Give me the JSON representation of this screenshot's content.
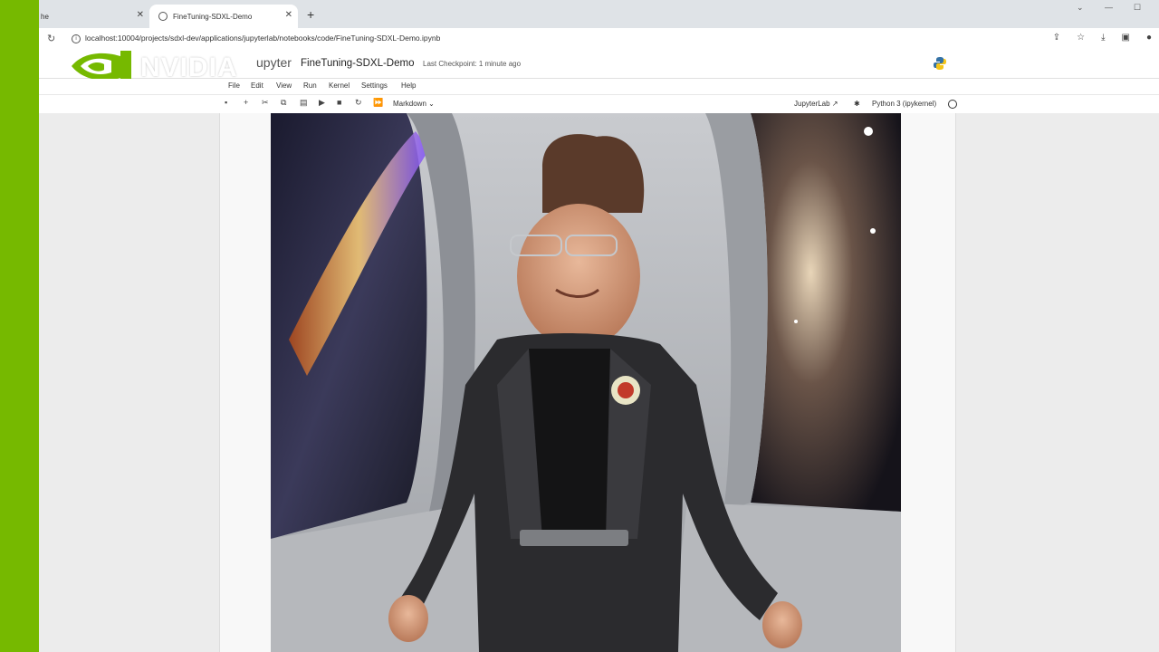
{
  "browser": {
    "tabs": [
      {
        "label": "he",
        "active": false
      },
      {
        "label": "FineTuning-SDXL-Demo",
        "active": true
      }
    ],
    "new_tab": "+",
    "url": "localhost:10004/projects/sdxl-dev/applications/jupyterlab/notebooks/code/FineTuning-SDXL-Demo.ipynb"
  },
  "overlay": {
    "brand": "NVIDIA"
  },
  "jupyter": {
    "logo_text": "upyter",
    "notebook_title": "FineTuning-SDXL-Demo",
    "checkpoint": "Last Checkpoint: 1 minute ago",
    "menu": [
      "File",
      "Edit",
      "View",
      "Run",
      "Kernel",
      "Settings",
      "Help"
    ],
    "cell_type": "Markdown",
    "jupyterlab_link": "JupyterLab",
    "kernel": "Python 3 (ipykernel)"
  },
  "colors": {
    "brand_green": "#76b900",
    "page_bg": "#ececec"
  }
}
